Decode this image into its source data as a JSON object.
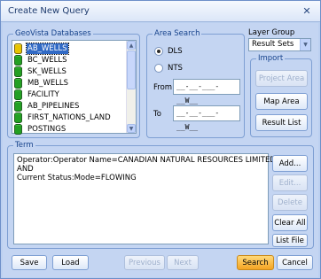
{
  "window": {
    "title": "Create New Query",
    "close_glyph": "✕"
  },
  "databases": {
    "title": "GeoVista Databases",
    "items": [
      {
        "label": "AB_WELLS",
        "selected": true
      },
      {
        "label": "BC_WELLS"
      },
      {
        "label": "SK_WELLS"
      },
      {
        "label": "MB_WELLS"
      },
      {
        "label": "FACILITY"
      },
      {
        "label": "AB_PIPELINES"
      },
      {
        "label": "FIRST_NATIONS_LAND"
      },
      {
        "label": "POSTINGS"
      }
    ],
    "icon": "database-icon"
  },
  "area_search": {
    "title": "Area Search",
    "options": [
      "DLS",
      "NTS"
    ],
    "selected": "DLS",
    "from_label": "From",
    "to_label": "To",
    "from_value": "__-__-___-__W__",
    "to_value": "__-__-___-__W__"
  },
  "layer_group": {
    "title": "Layer Group",
    "selected": "Result Sets"
  },
  "import": {
    "title": "Import",
    "project_area": "Project Area",
    "map_area": "Map Area",
    "result_list": "Result List"
  },
  "term": {
    "title": "Term",
    "lines": [
      "Operator:Operator Name=CANADIAN NATURAL RESOURCES LIMITED",
      "AND",
      "Current Status:Mode=FLOWING"
    ],
    "add": "Add...",
    "edit": "Edit...",
    "delete": "Delete",
    "clear_all": "Clear All",
    "list_file": "List File"
  },
  "footer": {
    "save": "Save",
    "load": "Load",
    "previous": "Previous",
    "next": "Next",
    "search": "Search",
    "cancel": "Cancel"
  },
  "colors": {
    "accent": "#316ac5",
    "search_button": "#f4a423",
    "db_icon": "#e8c400"
  }
}
